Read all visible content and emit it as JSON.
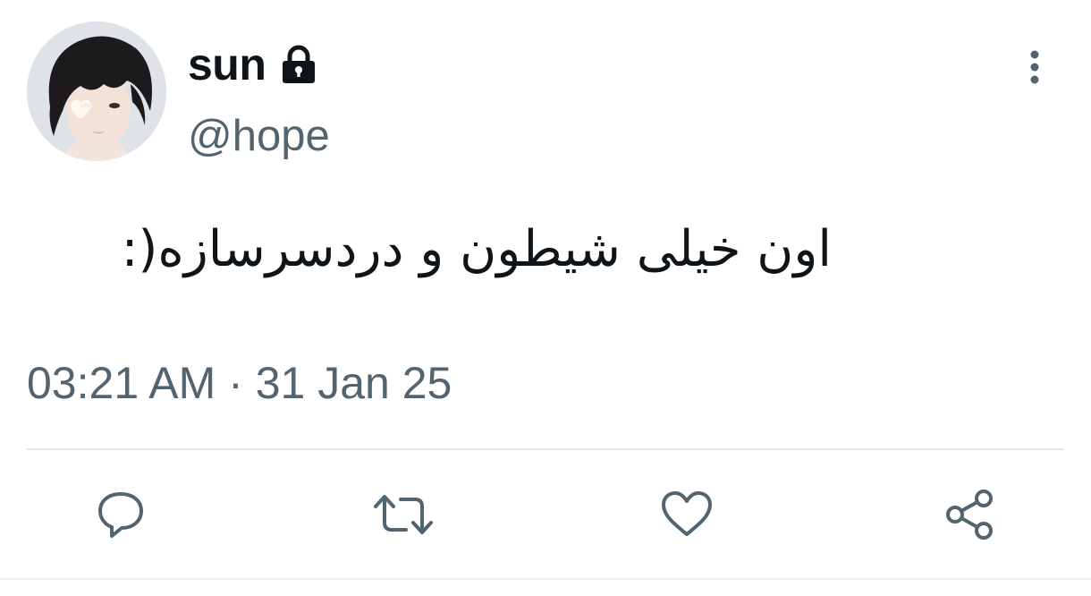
{
  "user": {
    "display_name": "sun",
    "handle": "@hope",
    "protected_icon": "lock-icon",
    "avatar": "profile-photo"
  },
  "tweet": {
    "text": "اون خیلی شیطون و دردسرسازه(:",
    "time": "03:21 AM",
    "separator": "·",
    "date": "31 Jan 25"
  },
  "actions": [
    {
      "name": "reply",
      "icon": "reply-icon"
    },
    {
      "name": "retweet",
      "icon": "retweet-icon"
    },
    {
      "name": "like",
      "icon": "heart-icon"
    },
    {
      "name": "share",
      "icon": "share-icon"
    }
  ],
  "more_icon": "more-vertical-icon",
  "colors": {
    "text_primary": "#0f1419",
    "text_secondary": "#536471",
    "divider": "#e3e7ea"
  }
}
